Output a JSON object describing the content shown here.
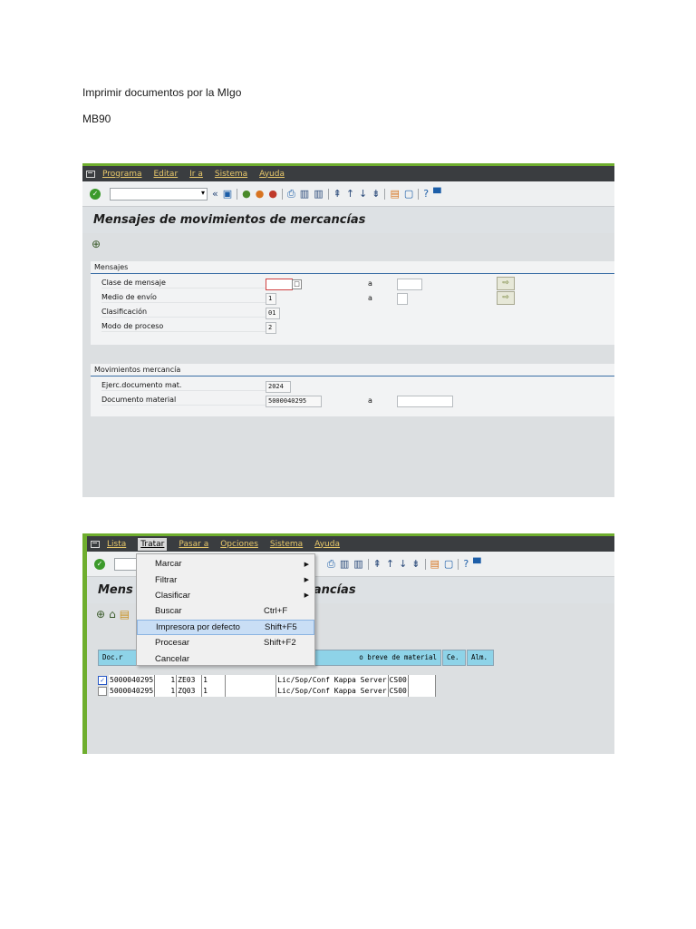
{
  "doc": {
    "line1": "Imprimir documentos por la MIgo",
    "line2": "MB90"
  },
  "shot1": {
    "menu": [
      "Programa",
      "Editar",
      "Ir a",
      "Sistema",
      "Ayuda"
    ],
    "title": "Mensajes de movimientos de mercancías",
    "group1": {
      "title": "Mensajes",
      "rows": [
        {
          "label": "Clase de mensaje",
          "value": "",
          "to": "a"
        },
        {
          "label": "Medio de envío",
          "value": "1",
          "to": "a"
        },
        {
          "label": "Clasificación",
          "value": "01",
          "to": ""
        },
        {
          "label": "Modo de proceso",
          "value": "2",
          "to": ""
        }
      ]
    },
    "group2": {
      "title": "Movimientos mercancía",
      "rows": [
        {
          "label": "Ejerc.documento mat.",
          "value": "2024",
          "to": ""
        },
        {
          "label": "Documento material",
          "value": "5000040295",
          "to": "a"
        }
      ]
    }
  },
  "shot2": {
    "menu": [
      "Lista",
      "Tratar",
      "Pasar a",
      "Opciones",
      "Sistema",
      "Ayuda"
    ],
    "title_left": "Mens",
    "title_right": "rcancías",
    "columns": [
      "Doc.r",
      "o breve de material",
      "Ce.",
      "Alm."
    ],
    "rows": [
      {
        "checked": true,
        "doc": "5000040295",
        "pos": "1",
        "cl": "ZE03",
        "n": "1",
        "text": "Lic/Sop/Conf Kappa Server",
        "ce": "CS00",
        "alm": ""
      },
      {
        "checked": false,
        "doc": "5000040295",
        "pos": "1",
        "cl": "ZQ03",
        "n": "1",
        "text": "Lic/Sop/Conf Kappa Server",
        "ce": "CS00",
        "alm": ""
      }
    ],
    "dropdown": [
      {
        "label": "Marcar",
        "shortcut": "",
        "submenu": true
      },
      {
        "label": "Filtrar",
        "shortcut": "",
        "submenu": true
      },
      {
        "label": "Clasificar",
        "shortcut": "",
        "submenu": true
      },
      {
        "label": "Buscar",
        "shortcut": "Ctrl+F",
        "submenu": false
      },
      {
        "label": "Impresora por defecto",
        "shortcut": "Shift+F5",
        "submenu": false,
        "highlighted": true
      },
      {
        "label": "Procesar",
        "shortcut": "Shift+F2",
        "submenu": false
      },
      {
        "label": "Cancelar",
        "shortcut": "",
        "submenu": false
      }
    ]
  },
  "colors": {
    "menubar": "#3a3d40",
    "menu_text": "#e8c86a",
    "accent_green": "#6fae2e",
    "grid_header": "#8ed3e8",
    "group_line": "#3a6ea5"
  },
  "icons": [
    "app-menu-icon",
    "ok-icon",
    "back-icon",
    "save-icon",
    "print-icon",
    "find-icon",
    "help-icon",
    "execute-icon",
    "select-options-icon",
    "checkbox-icon"
  ]
}
